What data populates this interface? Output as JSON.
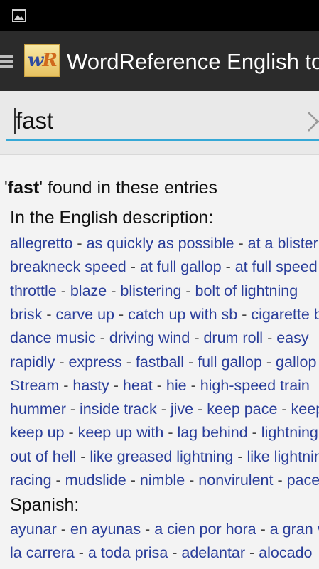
{
  "app": {
    "title": "WordReference English to Spanish",
    "logo_text": "wR"
  },
  "search": {
    "value": "fast"
  },
  "results": {
    "query_word": "fast",
    "header_open_quote": "'",
    "header_suffix": "' found in these entries",
    "sections": [
      {
        "heading": "In the English description:",
        "lines": [
          [
            "allegretto",
            "as quickly as possible",
            "at a blistering pace"
          ],
          [
            "breakneck speed",
            "at full gallop",
            "at full speed"
          ],
          [
            "throttle",
            "blaze",
            "blistering",
            "bolt of lightning"
          ],
          [
            "brisk",
            "carve up",
            "catch up with sb",
            "cigarette boat"
          ],
          [
            "dance music",
            "driving wind",
            "drum roll",
            "easy"
          ],
          [
            "rapidly",
            "express",
            "fastball",
            "full gallop",
            "gallop"
          ],
          [
            "Stream",
            "hasty",
            "heat",
            "hie",
            "high-speed train"
          ],
          [
            "hummer",
            "inside track",
            "jive",
            "keep pace",
            "keep"
          ],
          [
            "keep up",
            "keep up with",
            "lag behind",
            "lightning"
          ],
          [
            "out of hell",
            "like greased lightning",
            "like lightning"
          ],
          [
            "racing",
            "mudslide",
            "nimble",
            "nonvirulent",
            "pace"
          ]
        ]
      },
      {
        "heading": "Spanish:",
        "lines": [
          [
            "ayunar",
            "en ayunas",
            "a cien por hora",
            "a gran velocidad"
          ],
          [
            "la carrera",
            "a toda prisa",
            "adelantar",
            "alocado"
          ]
        ]
      }
    ]
  },
  "colors": {
    "link": "#2a3e9a",
    "accent": "#35a8d6",
    "action_bar": "#2b2b2b"
  },
  "icons": {
    "status": "image-icon",
    "menu": "menu-icon",
    "clear": "clear-icon"
  }
}
